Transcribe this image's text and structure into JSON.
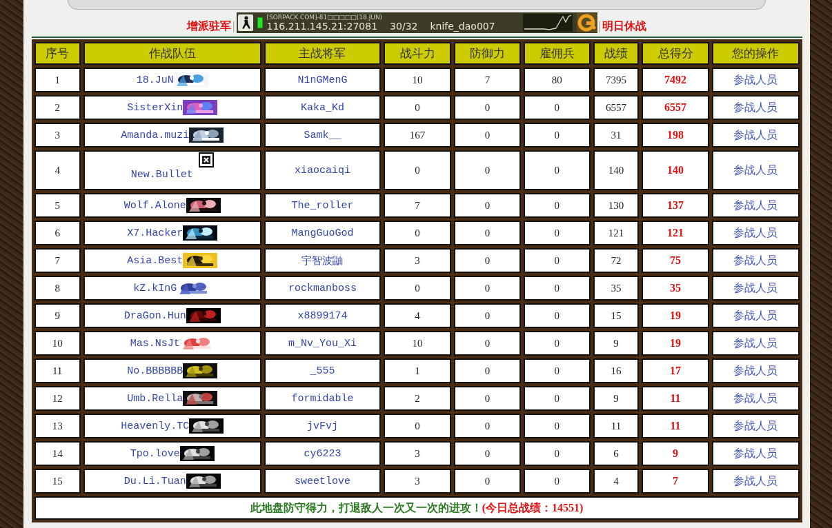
{
  "top_links": {
    "left": {
      "label": "增派驻军"
    },
    "left_separator": "|",
    "right_separator": "|",
    "right": {
      "label": "明日休战"
    }
  },
  "server_banner": {
    "title": "[SORPACK.COM]-81□□□□□(18.JUN)",
    "address": "116.211.145.21:27081",
    "players": "30/32",
    "map": "knife_dao007"
  },
  "table": {
    "columns": [
      "序号",
      "作战队伍",
      "主战将军",
      "战斗力",
      "防御力",
      "雇佣兵",
      "战绩",
      "总得分",
      "您的操作"
    ],
    "rows": [
      {
        "rank": "1",
        "team": "18.JuN",
        "general": "N1nGMenG",
        "attack": "10",
        "defense": "7",
        "mercenaries": "80",
        "record": "7395",
        "score": "7492",
        "action": "参战人员"
      },
      {
        "rank": "2",
        "team": "SisterXin",
        "general": "Kaka_Kd",
        "attack": "0",
        "defense": "0",
        "mercenaries": "0",
        "record": "6557",
        "score": "6557",
        "action": "参战人员"
      },
      {
        "rank": "3",
        "team": "Amanda.muzi",
        "general": "Samk__",
        "attack": "167",
        "defense": "0",
        "mercenaries": "0",
        "record": "31",
        "score": "198",
        "action": "参战人员"
      },
      {
        "rank": "4",
        "team": "New.Bullet",
        "logo": {
          "kind": "broken"
        },
        "general": "xiaocaiqi",
        "attack": "0",
        "defense": "0",
        "mercenaries": "0",
        "record": "140",
        "score": "140",
        "action": "参战人员"
      },
      {
        "rank": "5",
        "team": "Wolf.Alone",
        "general": "The_roller",
        "attack": "7",
        "defense": "0",
        "mercenaries": "0",
        "record": "130",
        "score": "137",
        "action": "参战人员"
      },
      {
        "rank": "6",
        "team": "X7.Hacker",
        "general": "MangGuoGod",
        "attack": "0",
        "defense": "0",
        "mercenaries": "0",
        "record": "121",
        "score": "121",
        "action": "参战人员"
      },
      {
        "rank": "7",
        "team": "Asia.Best",
        "general": "宇智波鼬",
        "attack": "3",
        "defense": "0",
        "mercenaries": "0",
        "record": "72",
        "score": "75",
        "action": "参战人员"
      },
      {
        "rank": "8",
        "team": "kZ.kInG",
        "general": "rockmanboss",
        "attack": "0",
        "defense": "0",
        "mercenaries": "0",
        "record": "35",
        "score": "35",
        "action": "参战人员"
      },
      {
        "rank": "9",
        "team": "DraGon.Hun",
        "general": "x8899174",
        "attack": "4",
        "defense": "0",
        "mercenaries": "0",
        "record": "15",
        "score": "19",
        "action": "参战人员"
      },
      {
        "rank": "10",
        "team": "Mas.NsJt",
        "general": "m_Nv_You_Xi",
        "attack": "10",
        "defense": "0",
        "mercenaries": "0",
        "record": "9",
        "score": "19",
        "action": "参战人员"
      },
      {
        "rank": "11",
        "team": "No.BBBBBB",
        "general": "_555",
        "attack": "1",
        "defense": "0",
        "mercenaries": "0",
        "record": "16",
        "score": "17",
        "action": "参战人员"
      },
      {
        "rank": "12",
        "team": "Umb.Rella",
        "general": "formidable",
        "attack": "2",
        "defense": "0",
        "mercenaries": "0",
        "record": "9",
        "score": "11",
        "action": "参战人员"
      },
      {
        "rank": "13",
        "team": "Heavenly.TC",
        "general": "jvFvj",
        "attack": "0",
        "defense": "0",
        "mercenaries": "0",
        "record": "11",
        "score": "11",
        "action": "参战人员"
      },
      {
        "rank": "14",
        "team": "Tpo.love",
        "general": "cy6223",
        "attack": "3",
        "defense": "0",
        "mercenaries": "0",
        "record": "6",
        "score": "9",
        "action": "参战人员"
      },
      {
        "rank": "15",
        "team": "Du.Li.Tuan",
        "general": "sweetlove",
        "attack": "3",
        "defense": "0",
        "mercenaries": "0",
        "record": "4",
        "score": "7",
        "action": "参战人员"
      }
    ]
  },
  "footer": {
    "message": "此地盘防守得力，打退敌人一次又一次的进攻！",
    "total": "(今日总战绩：14551)"
  }
}
